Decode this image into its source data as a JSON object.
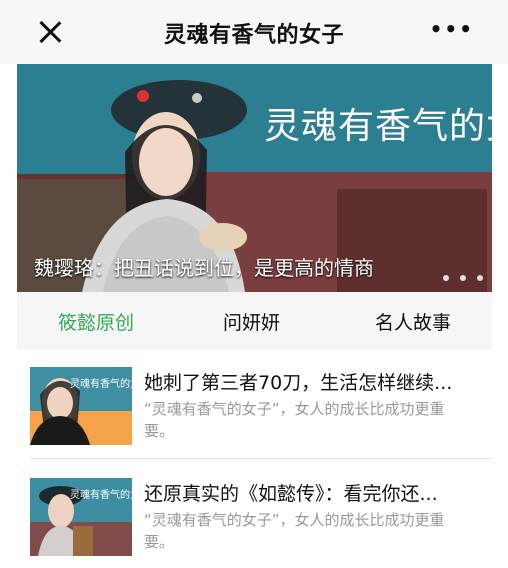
{
  "header": {
    "title": "灵魂有香气的女子",
    "more": "•••"
  },
  "banner": {
    "title": "灵魂有香气的女子",
    "caption": "魏璎珞：把丑话说到位，是更高的情商",
    "dots": [
      "•",
      "•",
      "•"
    ]
  },
  "tabs": [
    {
      "label": "筱懿原创",
      "active": true
    },
    {
      "label": "问妍妍",
      "active": false
    },
    {
      "label": "名人故事",
      "active": false
    }
  ],
  "articles": [
    {
      "title": "她刺了第三者70刀，生活怎样继续...",
      "desc": "“灵魂有香气的女子”，女人的成长比成功更重要。",
      "thumb_title": "灵魂有香气的女子"
    },
    {
      "title": "还原真实的《如懿传》：看完你还...",
      "desc": "“灵魂有香气的女子”，女人的成长比成功更重要。",
      "thumb_title": "灵魂有香气的女子"
    }
  ],
  "colors": {
    "accent": "#34a853",
    "banner_bg": "#2d7d91",
    "header_bg": "#f7f7f7"
  }
}
